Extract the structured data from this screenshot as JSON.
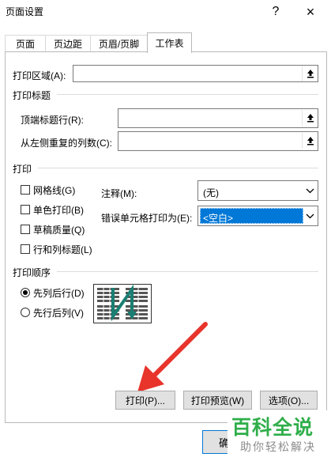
{
  "window": {
    "title": "页面设置",
    "help_glyph": "?",
    "close_glyph": "×"
  },
  "tabs": [
    {
      "label": "页面"
    },
    {
      "label": "页边距"
    },
    {
      "label": "页眉/页脚"
    },
    {
      "label": "工作表",
      "active": true
    }
  ],
  "print_area": {
    "label": "打印区域(A):",
    "value": ""
  },
  "print_titles": {
    "heading": "打印标题",
    "rows_label": "顶端标题行(R):",
    "cols_label": "从左侧重复的列数(C):"
  },
  "print": {
    "heading": "打印",
    "checkboxes": [
      {
        "label": "网格线(G)",
        "checked": false
      },
      {
        "label": "单色打印(B)",
        "checked": false
      },
      {
        "label": "草稿质量(Q)",
        "checked": false
      },
      {
        "label": "行和列标题(L)",
        "checked": false
      }
    ],
    "comments_label": "注释(M):",
    "comments_value": "(无)",
    "errors_label": "错误单元格打印为(E):",
    "errors_value": "<空白>"
  },
  "page_order": {
    "heading": "打印顺序",
    "options": [
      {
        "label": "先列后行(D)",
        "selected": true
      },
      {
        "label": "先行后列(V)",
        "selected": false
      }
    ]
  },
  "buttons": {
    "print": "打印(P)...",
    "preview": "打印预览(W)",
    "options": "选项(O)...",
    "ok": "确"
  },
  "watermark": {
    "main": "百科全说",
    "sub": "助你轻松解决"
  },
  "colors": {
    "accent": "#0078d7",
    "arrow": "#e8342b",
    "watermark_green": "#2fae4a",
    "order_arrow": "#1a7f72"
  }
}
